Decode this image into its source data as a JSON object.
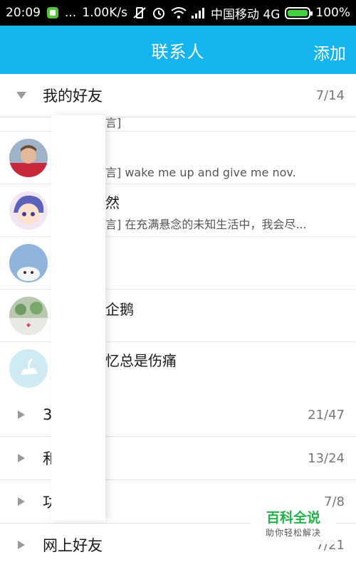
{
  "status_bar": {
    "time": "20:09",
    "dots": "...",
    "speed": "1.00K/s",
    "carrier": "中国移动 4G",
    "battery_text": "100%",
    "battery_level": 1.0,
    "colors": {
      "battery": "#43d13d",
      "sim_icon": "#52c53c"
    },
    "icons": [
      "app-notification-icon",
      "vibrate-off-icon",
      "alarm-icon",
      "wifi-icon",
      "signal-icon",
      "battery-icon"
    ]
  },
  "header": {
    "title": "联系人",
    "add_label": "添加",
    "color": "#14b4ee"
  },
  "groups": [
    {
      "name": "我的好友",
      "count": "7/14",
      "expanded": true
    },
    {
      "name": "3",
      "count": "21/47",
      "expanded": false
    },
    {
      "name": "和",
      "count": "13/24",
      "expanded": false
    },
    {
      "name": "功",
      "count": "7/8",
      "expanded": false
    },
    {
      "name": "网上好友",
      "count": "7/21",
      "expanded": false
    }
  ],
  "contacts": [
    {
      "name": "",
      "signature": "言]"
    },
    {
      "name": "",
      "signature": "言] wake me up and give me nov."
    },
    {
      "name": "然",
      "signature": "言] 在充满悬念的未知生活中，我会尽..."
    },
    {
      "name": "",
      "signature": ""
    },
    {
      "name": "企鹅",
      "signature": ""
    },
    {
      "name": "忆总是伤痛",
      "signature": ""
    }
  ],
  "watermark": {
    "main": "百科全说",
    "sub": "助你轻松解决"
  }
}
